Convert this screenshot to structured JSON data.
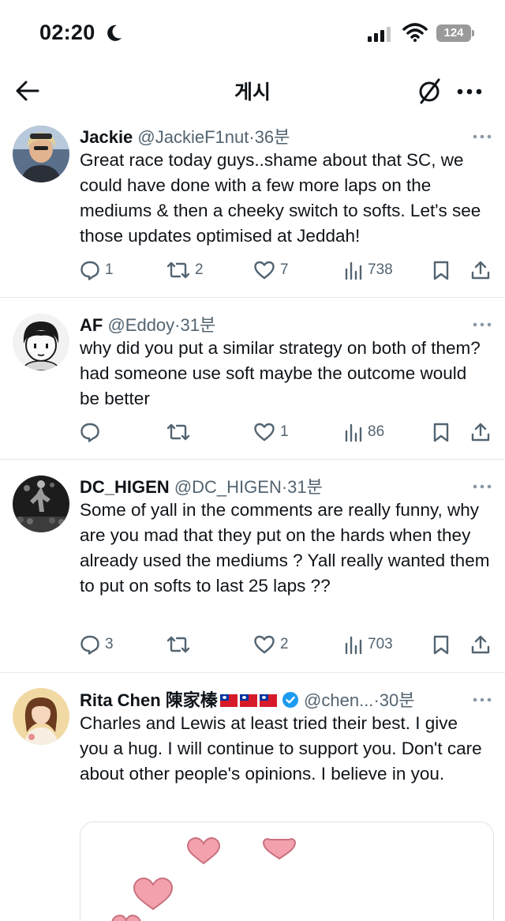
{
  "status_bar": {
    "time": "02:20",
    "battery": "124"
  },
  "nav": {
    "title": "게시"
  },
  "tweets": [
    {
      "name": "Jackie",
      "handle": "@JackieF1nut",
      "time": "·36분",
      "text": "Great race today guys..shame about that SC, we could have done with a few more laps on the mediums & then a cheeky switch to softs. Let's see those updates optimised at Jeddah!",
      "replies": "1",
      "retweets": "2",
      "likes": "7",
      "views": "738"
    },
    {
      "name": "AF",
      "handle": "@Eddoy",
      "time": "·31분",
      "text": "why did you put a similar strategy on both of them? had someone use soft maybe the outcome would be better",
      "replies": "",
      "retweets": "",
      "likes": "1",
      "views": "86"
    },
    {
      "name": "DC_HIGEN",
      "handle": "@DC_HIGEN",
      "time": "·31분",
      "text": "Some of yall in the comments are really funny, why are you mad that they put on the hards when they already used the mediums ? Yall really wanted them to put on softs to last 25 laps ??",
      "replies": "3",
      "retweets": "",
      "likes": "2",
      "views": "703"
    },
    {
      "name": "Rita Chen 陳家榛",
      "handle": "@chen...",
      "time": "·30분",
      "text": "Charles and Lewis at least tried their best. I give you a hug. I will continue to support you. Don't care about other people's opinions. I believe in you."
    }
  ],
  "icons": {
    "back": "arrow-left-icon",
    "no_translate": "slashed-circle-icon",
    "more": "more-horizontal-icon",
    "reply": "speech-bubble-icon",
    "retweet": "retweet-icon",
    "like": "heart-icon",
    "views": "bar-chart-icon",
    "bookmark": "bookmark-icon",
    "share": "share-icon"
  },
  "colors": {
    "text": "#0f1419",
    "secondary": "#536471",
    "verified": "#1d9bf0",
    "divider": "#e6e8ea",
    "heart_sticker": "#f3a1ad"
  }
}
